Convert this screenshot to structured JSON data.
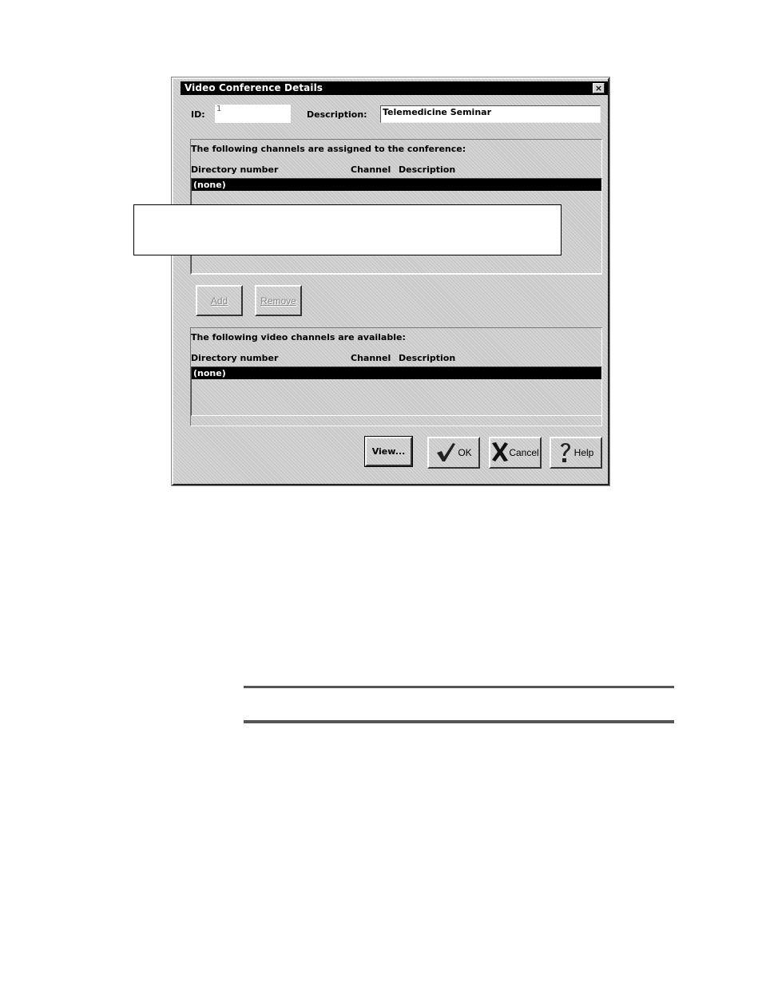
{
  "dialog": {
    "title": "Video Conference Details",
    "close_label": "×",
    "id_label": "ID:",
    "id_value": "1",
    "description_label": "Description:",
    "description_value": "Telemedicine Seminar"
  },
  "assigned": {
    "heading": "The following channels are assigned to the conference:",
    "columns": [
      "Directory number",
      "Channel",
      "Description"
    ],
    "rows": [
      "(none)"
    ]
  },
  "available": {
    "heading": "The following video channels are available:",
    "columns": [
      "Directory number",
      "Channel",
      "Description"
    ],
    "rows": [
      "(none)"
    ]
  },
  "buttons": {
    "add": "Add",
    "remove": "Remove",
    "view": "View...",
    "ok": "OK",
    "cancel": "Cancel",
    "help": "Help"
  },
  "icons": {
    "ok": "checkmark-icon",
    "cancel": "x-mark-icon",
    "help": "question-mark-icon"
  }
}
